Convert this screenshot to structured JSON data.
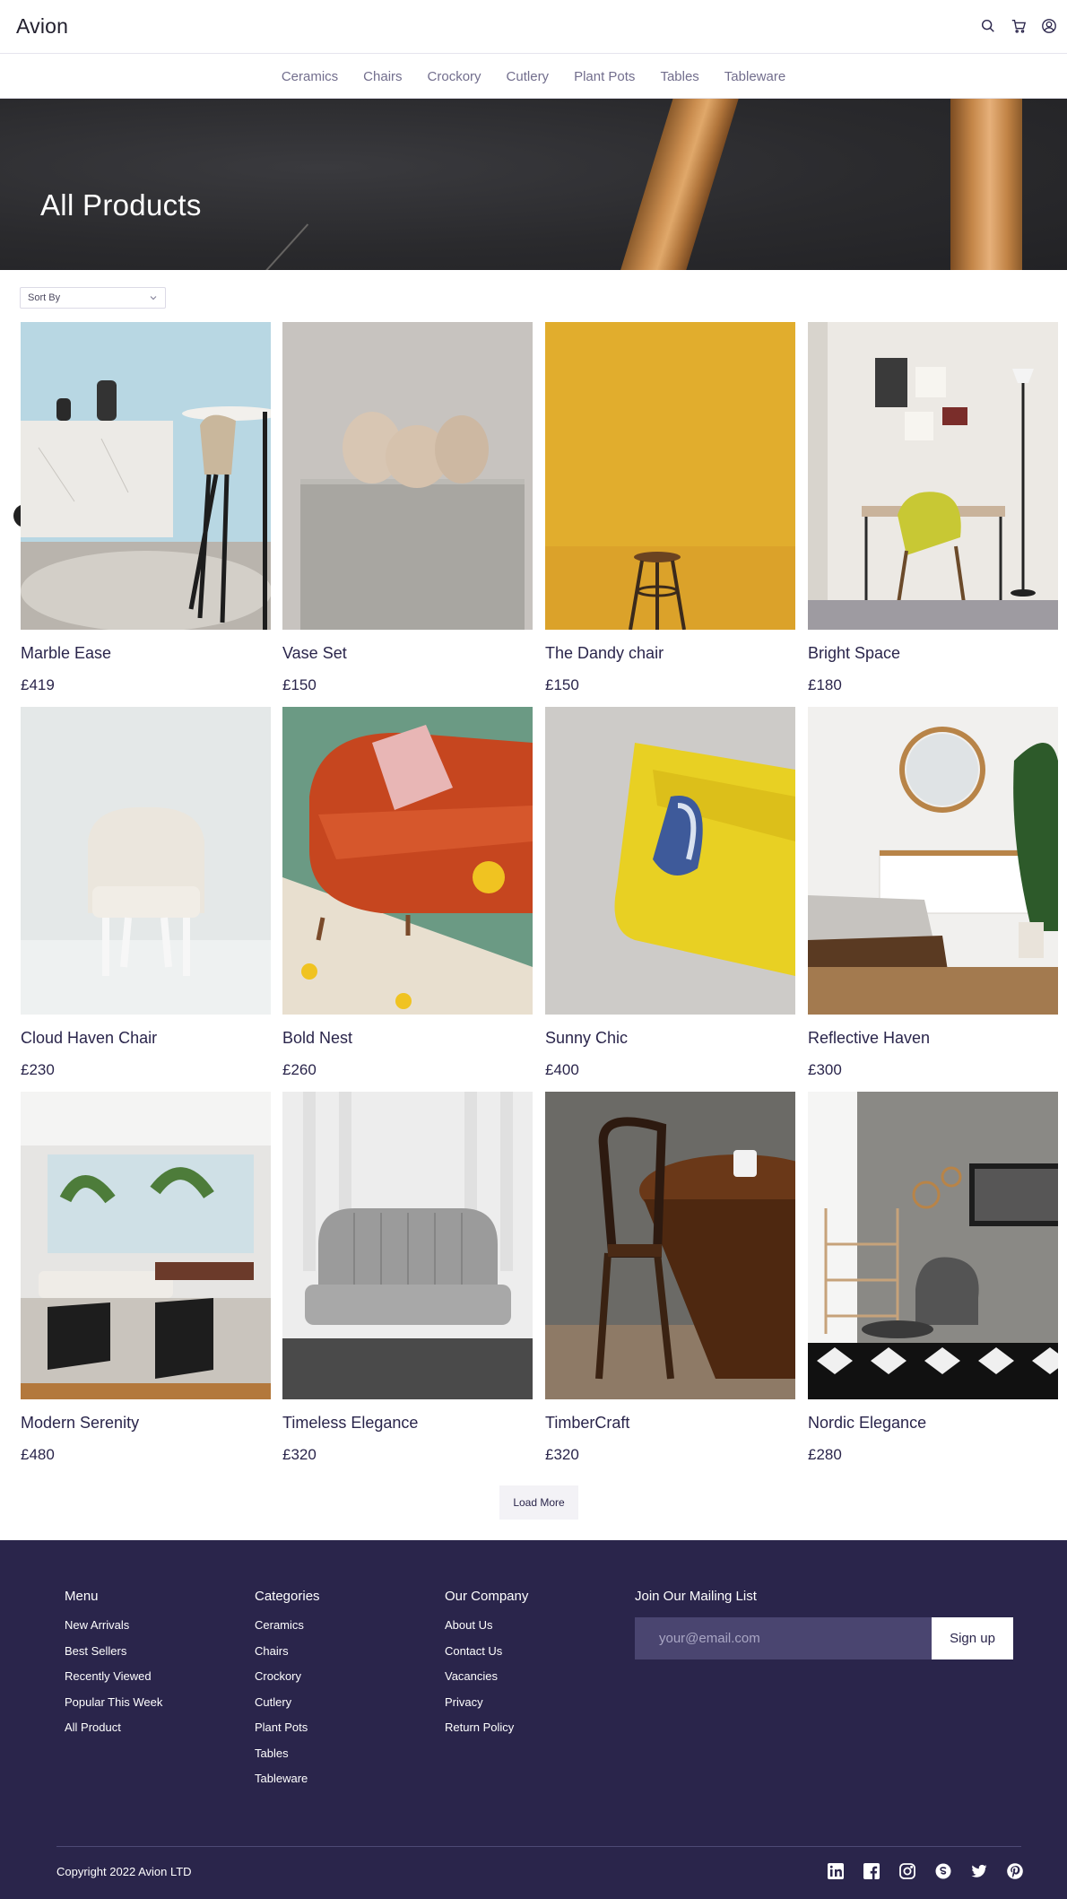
{
  "header": {
    "brand": "Avion",
    "icons": [
      "search-icon",
      "cart-icon",
      "user-icon"
    ]
  },
  "nav": {
    "items": [
      "Ceramics",
      "Chairs",
      "Crockory",
      "Cutlery",
      "Plant Pots",
      "Tables",
      "Tableware"
    ]
  },
  "hero": {
    "title": "All Products"
  },
  "sort": {
    "label": "Sort By"
  },
  "products": [
    {
      "name": "Marble Ease",
      "price": "£419"
    },
    {
      "name": "Vase Set",
      "price": "£150"
    },
    {
      "name": "The Dandy chair",
      "price": "£150"
    },
    {
      "name": "Bright Space",
      "price": "£180"
    },
    {
      "name": "Cloud Haven Chair",
      "price": "£230"
    },
    {
      "name": "Bold Nest",
      "price": "£260"
    },
    {
      "name": "Sunny Chic",
      "price": "£400"
    },
    {
      "name": "Reflective Haven",
      "price": "£300"
    },
    {
      "name": "Modern Serenity",
      "price": "£480"
    },
    {
      "name": "Timeless Elegance",
      "price": "£320"
    },
    {
      "name": "TimberCraft",
      "price": "£320"
    },
    {
      "name": "Nordic Elegance",
      "price": "£280"
    }
  ],
  "load_more": "Load More",
  "footer": {
    "menu": {
      "heading": "Menu",
      "links": [
        "New Arrivals",
        "Best Sellers",
        "Recently Viewed",
        "Popular This Week",
        "All Product"
      ]
    },
    "categories": {
      "heading": "Categories",
      "links": [
        "Ceramics",
        "Chairs",
        "Crockory",
        "Cutlery",
        "Plant Pots",
        "Tables",
        "Tableware"
      ]
    },
    "company": {
      "heading": "Our Company",
      "links": [
        "About Us",
        "Contact Us",
        "Vacancies",
        "Privacy",
        "Return Policy"
      ]
    },
    "mailing": {
      "heading": "Join Our Mailing List",
      "placeholder": "your@email.com",
      "button": "Sign up"
    },
    "copyright": "Copyright 2022 Avion LTD",
    "socials": [
      "linkedin-icon",
      "facebook-icon",
      "instagram-icon",
      "skype-icon",
      "twitter-icon",
      "pinterest-icon"
    ]
  },
  "colors": {
    "primary": "#2a254b",
    "muted": "#726e8d",
    "footer_bg": "#2a254b",
    "input_bg": "#4a4570"
  }
}
